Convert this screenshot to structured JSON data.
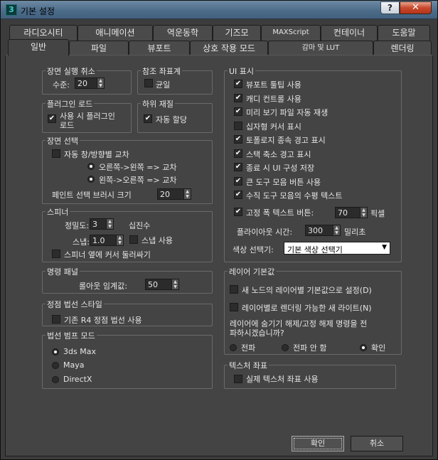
{
  "window": {
    "title": "기본 설정",
    "help_label": "?",
    "close_label": "✕"
  },
  "tabs_row1": [
    "라디오시티",
    "애니메이션",
    "역운동학",
    "기즈모",
    "MAXScript",
    "컨테이너",
    "도움말"
  ],
  "tabs_row2": [
    "일반",
    "파일",
    "뷰포트",
    "상호 작용 모드",
    "감마 및 LUT",
    "렌더링"
  ],
  "active_tab": "일반",
  "scene_undo": {
    "title": "장면 실행 취소",
    "level_label": "수준:",
    "level_value": "20"
  },
  "ref_coord": {
    "title": "참조 좌표계",
    "uniform_label": "균일",
    "uniform_checked": false
  },
  "plugin_load": {
    "title": "플러그인 로드",
    "load_label_1": "사용 시 플러그인",
    "load_label_2": "로드",
    "load_checked": true
  },
  "sub_material": {
    "title": "하위 재질",
    "auto_assign_label": "자동 할당",
    "auto_assign_checked": true
  },
  "scene_selection": {
    "title": "장면 선택",
    "auto_cross_label": "자동 창/방향별 교차",
    "auto_cross_checked": false,
    "r2l_label": "오른쪽->왼쪽 => 교차",
    "l2r_label": "왼쪽->오른쪽 => 교차",
    "brush_label": "페인트 선택 브러시 크기",
    "brush_value": "20"
  },
  "spinner": {
    "title": "스피너",
    "precision_label": "정밀도:",
    "precision_value": "3",
    "decimal_label": "십진수",
    "snap_label": "스냅:",
    "snap_value": "1.0",
    "snap_use_label": "스냅 사용",
    "wrap_label": "스피너 옆에 커서 둘러싸기"
  },
  "command_panel": {
    "title": "명령 패널",
    "rollout_label": "롤아웃 임계값:",
    "rollout_value": "50"
  },
  "vertex_normal": {
    "title": "정점 법선 스타일",
    "r4_label": "기존 R4 정점 법선 사용"
  },
  "normal_bump": {
    "title": "법선 범프 모드",
    "options": [
      "3ds Max",
      "Maya",
      "DirectX"
    ],
    "selected": "3ds Max"
  },
  "ui_display": {
    "title": "UI 표시",
    "items": [
      {
        "label": "뷰포트 툴팁 사용",
        "checked": true
      },
      {
        "label": "캐디 컨트롤 사용",
        "checked": true
      },
      {
        "label": "미리 보기 파일 자동 재생",
        "checked": true
      },
      {
        "label": "십자형 커서 표시",
        "checked": false
      },
      {
        "label": "토폴로지 종속 경고 표시",
        "checked": true
      },
      {
        "label": "스택 축소 경고 표시",
        "checked": true
      },
      {
        "label": "종료 시 UI 구성 저장",
        "checked": true
      },
      {
        "label": "큰 도구 모음 버튼 사용",
        "checked": true
      },
      {
        "label": "수직 도구 모음의 수평 텍스트",
        "checked": true
      }
    ],
    "fixed_width_label": "고정 폭 텍스트 버튼:",
    "fixed_width_checked": true,
    "fixed_width_value": "70",
    "pixel_label": "픽셀",
    "flyout_label": "플라이아웃 시간:",
    "flyout_value": "300",
    "ms_label": "밀리초",
    "color_picker_label": "색상 선택기:",
    "color_picker_value": "기본 색상 선택기"
  },
  "layer_default": {
    "title": "레이어 기본값",
    "node_layer_label": "새 노드의 레이어별 기본값으로 설정(D)",
    "render_light_label": "레이어별로 렌더링 가능한 새 라이트(N)",
    "propagate_label_1": "레이어에 숨기기 해제/고정 해제 명령을 전",
    "propagate_label_2": "파하시겠습니까?",
    "options": [
      "전파",
      "전파 안 함",
      "확인"
    ],
    "selected": "확인"
  },
  "texture_coord": {
    "title": "텍스처 좌표",
    "real_label": "실제 텍스처 좌표 사용"
  },
  "buttons": {
    "ok": "확인",
    "cancel": "취소"
  }
}
